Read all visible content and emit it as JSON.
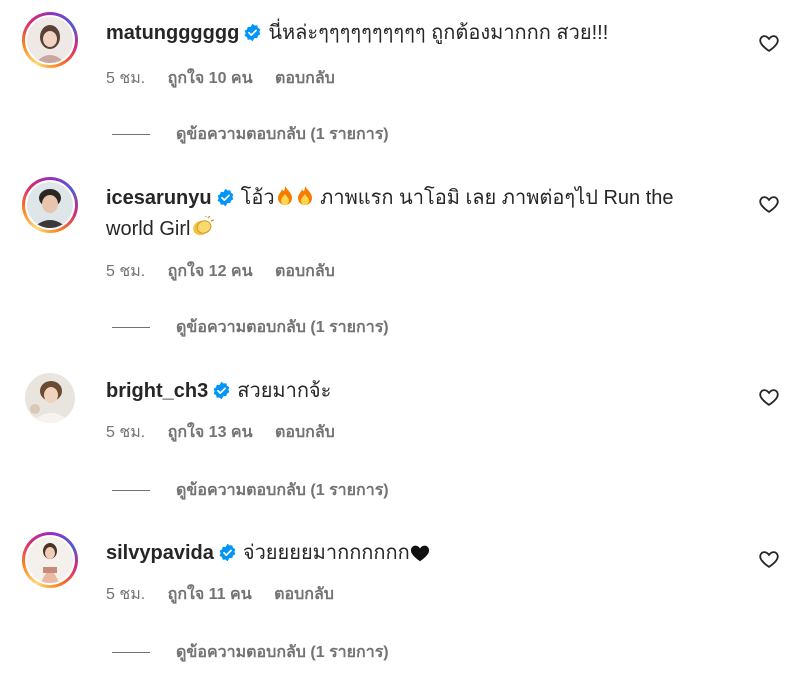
{
  "comments": [
    {
      "username": "matungggggg",
      "text": "นี่หล่ะๆๆๆๆๆๆๆๆๆๆ ถูกต้องมากกก สวย!!!",
      "time": "5 ชม.",
      "likes": "ถูกใจ 10 คน",
      "reply": "ตอบกลับ",
      "view_replies": "ดูข้อความตอบกลับ (1 รายการ)"
    },
    {
      "username": "icesarunyu",
      "text_a": "โอ้ว",
      "text_b": " ภาพแรก นาโอมิ เลย ภาพต่อๆไป Run the",
      "text_c": "world Girl",
      "time": "5 ชม.",
      "likes": "ถูกใจ 12 คน",
      "reply": "ตอบกลับ",
      "view_replies": "ดูข้อความตอบกลับ (1 รายการ)"
    },
    {
      "username": "bright_ch3",
      "text": "สวยมากจ้ะ",
      "time": "5 ชม.",
      "likes": "ถูกใจ 13 คน",
      "reply": "ตอบกลับ",
      "view_replies": "ดูข้อความตอบกลับ (1 รายการ)"
    },
    {
      "username": "silvypavida",
      "text": "จ่วยยยยมากกกกกก",
      "time": "5 ชม.",
      "likes": "ถูกใจ 11 คน",
      "reply": "ตอบกลับ",
      "view_replies": "ดูข้อความตอบกลับ (1 รายการ)"
    }
  ],
  "colors": {
    "verified": "#0095f6",
    "secondary_text": "#737373",
    "primary_text": "#262626"
  },
  "icons": {
    "verified": "verified-badge-icon",
    "heart": "heart-outline-icon",
    "fire": "fire-emoji",
    "clap": "clapping-hands-emoji",
    "black_heart": "black-heart-emoji"
  }
}
